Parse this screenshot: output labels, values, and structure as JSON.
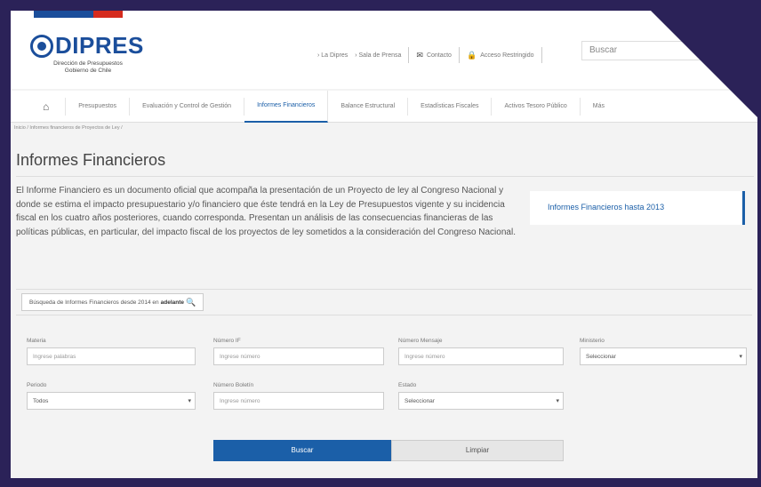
{
  "header": {
    "logo_text": "DIPRES",
    "logo_subtitle_line1": "Dirección de Presupuestos",
    "logo_subtitle_line2": "Gobierno de Chile",
    "flag_colors": [
      "#1b4e9b",
      "#1b4e9b",
      "#d52b1e"
    ],
    "links": {
      "la_dipres": "› La Dipres",
      "sala_prensa": "› Sala de Prensa",
      "contacto": "Contacto",
      "acceso": "Acceso Restringido"
    },
    "search_placeholder": "Buscar"
  },
  "nav": {
    "items": [
      "Presupuestos",
      "Evaluación y Control de Gestión",
      "Informes Financieros",
      "Balance Estructural",
      "Estadísticas Fiscales",
      "Activos Tesoro Público",
      "Más"
    ],
    "active_index": 2
  },
  "breadcrumb": "Inicio / Informes financieros de Proyectos de Ley /",
  "page_title": "Informes Financieros",
  "intro_text": "El Informe Financiero es un documento oficial que acompaña la presentación de un Proyecto de ley al Congreso Nacional y donde se estima el impacto presupuestario y/o financiero que éste tendrá en la Ley de Presupuestos vigente y su incidencia fiscal en los cuatro años posteriores, cuando corresponda. Presentan un análisis de las consecuencias financieras de las políticas públicas, en particular, del impacto fiscal de los proyectos de ley sometidos a la consideración del Congreso Nacional.",
  "side_link": "Informes Financieros hasta 2013",
  "advanced_search": {
    "label": "Búsqueda de Informes Financieros desde 2014 en",
    "bold": "adelante"
  },
  "form": {
    "materia": {
      "label": "Materia",
      "placeholder": "Ingrese palabras"
    },
    "numero_if": {
      "label": "Número IF",
      "placeholder": "Ingrese número"
    },
    "numero_mensaje": {
      "label": "Número Mensaje",
      "placeholder": "Ingrese número"
    },
    "ministerio": {
      "label": "Ministerio",
      "value": "Seleccionar"
    },
    "periodo": {
      "label": "Periodo",
      "value": "Todos"
    },
    "numero_boletin": {
      "label": "Número Boletín",
      "placeholder": "Ingrese número"
    },
    "estado": {
      "label": "Estado",
      "value": "Seleccionar"
    }
  },
  "buttons": {
    "buscar": "Buscar",
    "limpiar": "Limpiar"
  },
  "colors": {
    "frame": "#2b2258",
    "accent": "#1b5fa8",
    "brand": "#1b4e9b"
  }
}
